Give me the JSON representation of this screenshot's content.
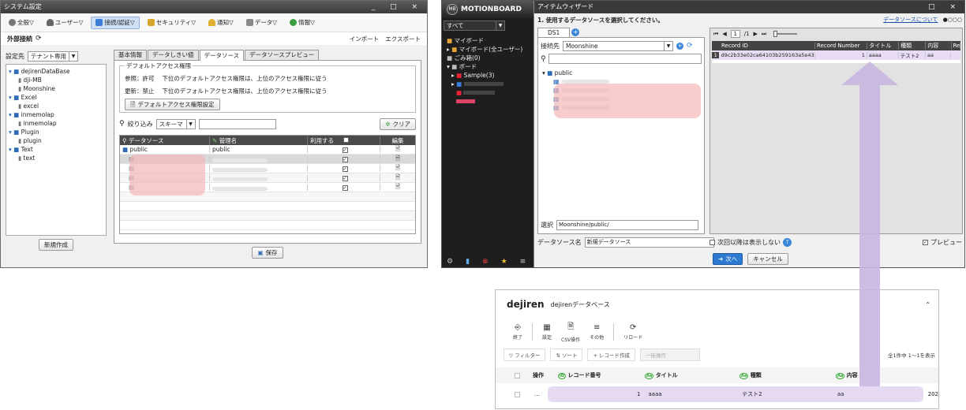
{
  "sys": {
    "title": "システム設定",
    "title_controls": "_ □ ×",
    "tabs": [
      "全般▽",
      "ユーザー▽",
      "接続/認証▽",
      "セキュリティ▽",
      "通知▽",
      "データ▽",
      "情報▽"
    ],
    "section": "外部接続",
    "import": "インポート",
    "export": "エクスポート",
    "target_label": "設定先",
    "target_value": "テナント専用",
    "tree": [
      {
        "label": "dejirenDataBase",
        "level": 0,
        "type": "db"
      },
      {
        "label": "dji-MB",
        "level": 1,
        "type": "item"
      },
      {
        "label": "Moonshine",
        "level": 1,
        "type": "item"
      },
      {
        "label": "Excel",
        "level": 0,
        "type": "db"
      },
      {
        "label": "excel",
        "level": 1,
        "type": "item"
      },
      {
        "label": "inmemolap",
        "level": 0,
        "type": "db"
      },
      {
        "label": "inmemolap",
        "level": 1,
        "type": "item"
      },
      {
        "label": "Plugin",
        "level": 0,
        "type": "db"
      },
      {
        "label": "plugin",
        "level": 1,
        "type": "item"
      },
      {
        "label": "Text",
        "level": 0,
        "type": "db"
      },
      {
        "label": "text",
        "level": 1,
        "type": "item"
      }
    ],
    "new_button": "新規作成",
    "inner_tabs": [
      "基本情報",
      "データしきい値",
      "データソース",
      "データソースプレビュー"
    ],
    "access_group": "デフォルトアクセス権限",
    "access_ref": "参照：許可　 下位のデフォルトアクセス権限は、上位のアクセス権限に従う",
    "access_upd": "更新：禁止　 下位のデフォルトアクセス権限は、上位のアクセス権限に従う",
    "access_button": "デフォルトアクセス権限設定",
    "filter_label": "絞り込み",
    "filter_value": "スキーマ",
    "clear_button": "クリア",
    "cols": [
      "データソース",
      "管理名",
      "利用する",
      "編集"
    ],
    "first_row": {
      "ds": "public",
      "name": "public"
    },
    "save_button": "保存"
  },
  "mb": {
    "logo": "MOTIONBOARD",
    "filter": "すべて",
    "side": [
      "マイボード",
      "マイボード(全ユーザー)",
      "ごみ箱(0)",
      "ボード",
      "Sample(3)"
    ],
    "wizard_title": "アイテムウィザード",
    "title_controls": "□ ×",
    "step": "1. 使用するデータソースを選択してください。",
    "about_link": "データソースについて",
    "dots": "●○○○",
    "tab": "DS1",
    "conn_label": "接続先",
    "conn_value": "Moonshine",
    "schema": "public",
    "sel_label": "選択",
    "sel_value": "Moonshine/public/",
    "page": "1",
    "page_total": "/1",
    "grid_cols": [
      "Record ID",
      "Record Number",
      "タイトル",
      "種類",
      "内容",
      "Re"
    ],
    "grid_row": [
      "d9c2b33e02ca64103b259163a5e432f7a",
      "1",
      "aaaa",
      "テスト2",
      "aa",
      ""
    ],
    "grid_row_num": "1",
    "dsname_label": "データソース名",
    "dsname_value": "新規データソース",
    "skip_label": "次回以降は表示しない",
    "preview_label": "プレビュー",
    "next_button": "次へ",
    "cancel_button": "キャンセル"
  },
  "dj": {
    "logo": "dejiren",
    "db_title": "dejirenデータベース",
    "tools": [
      "終了",
      "設定",
      "CSV操作",
      "その他",
      "リロード"
    ],
    "filter": "フィルター",
    "sort": "ソート",
    "create": "レコード作成",
    "bulk": "一括操作",
    "count": "全1件中 1〜1を表示",
    "cols": [
      "操作",
      "レコード番号",
      "タイトル",
      "種類",
      "内容"
    ],
    "row": [
      "…",
      "1",
      "aaaa",
      "テスト2",
      "aa",
      "202"
    ]
  },
  "colors": {
    "accent": "#2e6db5",
    "arrow": "#c9b6e0",
    "blur": "#f4b7b7"
  }
}
